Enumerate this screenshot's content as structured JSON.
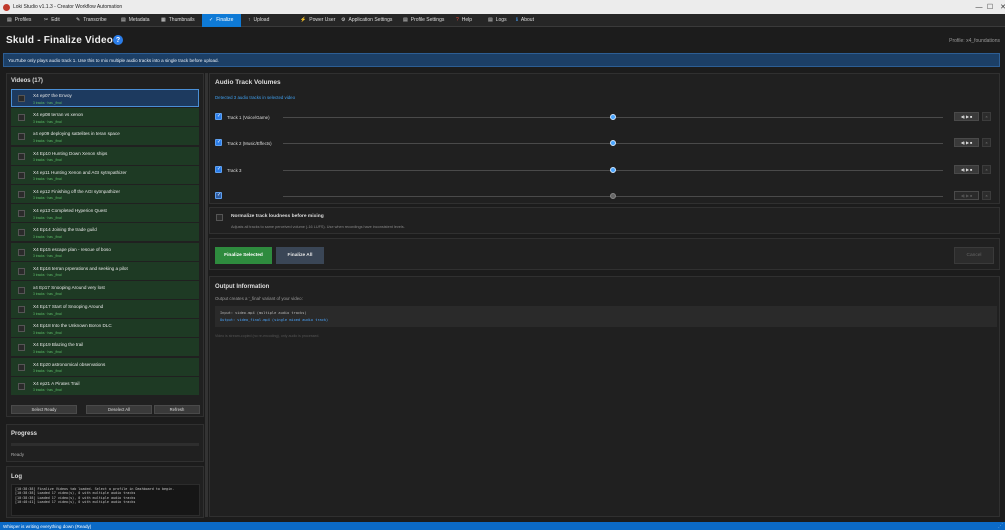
{
  "window": {
    "title": "Loki Studio v1.1.3 - Creator Workflow Automation",
    "minimize": "—",
    "maximize": "☐",
    "close": "✕"
  },
  "tabs": [
    {
      "icon": "▤",
      "label": "Profiles"
    },
    {
      "icon": "✂",
      "label": "Edit"
    },
    {
      "icon": "✎",
      "label": "Transcribe"
    },
    {
      "icon": "▤",
      "label": "Metadata"
    },
    {
      "icon": "▦",
      "label": "Thumbnails"
    },
    {
      "icon": "✓",
      "label": "Finalize"
    },
    {
      "icon": "↑",
      "label": "Upload"
    },
    {
      "icon": "⚡",
      "label": "Power User"
    },
    {
      "icon": "⚙",
      "label": "Application Settings"
    },
    {
      "icon": "▤",
      "label": "Profile Settings"
    },
    {
      "icon": "?",
      "label": "Help"
    },
    {
      "icon": "▤",
      "label": "Logs"
    },
    {
      "icon": "ℹ",
      "label": "About"
    }
  ],
  "header": {
    "title": "Skuld - Finalize Videos",
    "help_icon": "?",
    "profile": "Profile: x4_foundations"
  },
  "banner": "YouTube only plays audio track 1. Use this to mix multiple audio tracks into a single track before upload.",
  "videos": {
    "title": "Videos (17)",
    "items": [
      {
        "title": "X4 ep07 the Envoy",
        "subtitle": "3 tracks · has _final"
      },
      {
        "title": "X4 ep08 terran vs xenon",
        "subtitle": "3 tracks · has _final"
      },
      {
        "title": "x4 ep09 deploying sattelites in teran space",
        "subtitle": "3 tracks · has _final"
      },
      {
        "title": "X4 Ep10 Hunting Down Xenon ships",
        "subtitle": "3 tracks · has _final"
      },
      {
        "title": "X4 ep11 Hunting Xenon and AGI sytmpathizer",
        "subtitle": "3 tracks · has _final"
      },
      {
        "title": "X4 ep12 Finishing off the AGI sytmpathizer",
        "subtitle": "3 tracks · has _final"
      },
      {
        "title": "X4 ep13 Completed Hyperion Quest",
        "subtitle": "3 tracks · has _final"
      },
      {
        "title": "X4 Ep14 Joining the trade guild",
        "subtitle": "3 tracks · has _final"
      },
      {
        "title": "X4 Ep15 escape plan - rescue of boso",
        "subtitle": "3 tracks · has _final"
      },
      {
        "title": "X4 Ep16 terran prperations and seeking a pilot",
        "subtitle": "3 tracks · has _final"
      },
      {
        "title": "x4 Ep17 Snooping Around very lost",
        "subtitle": "3 tracks · has _final"
      },
      {
        "title": "X4 Ep17 Start of Snooping Around",
        "subtitle": "3 tracks · has _final"
      },
      {
        "title": "X4 Ep18 Into the Unknown Boron DLC",
        "subtitle": "3 tracks · has _final"
      },
      {
        "title": "X4 Ep19 Blazing the trail",
        "subtitle": "3 tracks · has _final"
      },
      {
        "title": "X4 Ep20 astronomical observations",
        "subtitle": "3 tracks · has _final"
      },
      {
        "title": "X4 ep21 A Pirates Trail",
        "subtitle": "3 tracks · has _final"
      }
    ],
    "select_ready": "Select Ready",
    "deselect_all": "Deselect All",
    "refresh": "Refresh"
  },
  "progress": {
    "title": "Progress",
    "value": 0,
    "status": "Ready"
  },
  "log": {
    "title": "Log",
    "lines": [
      "[10:38:38] Finalize Videos tab loaded. Select a profile in Dashboard to begin.",
      "[10:38:38] Loaded 17 video(s), 0 with multiple audio tracks",
      "[10:38:38] Loaded 17 video(s), 0 with multiple audio tracks",
      "[10:40:41] Loaded 17 video(s), 0 with multiple audio tracks"
    ]
  },
  "audio": {
    "title": "Audio Track Volumes",
    "detected": "Detected 3 audio tracks in selected video",
    "tracks": [
      {
        "label": "Track 1 (Voice/Game)",
        "value": 0.5,
        "preview": "◀) ▶ ■",
        "remove": "×",
        "enabled": true
      },
      {
        "label": "Track 2 (Music/Effects)",
        "value": 0.5,
        "preview": "◀) ▶ ■",
        "remove": "×",
        "enabled": true
      },
      {
        "label": "Track 3",
        "value": 0.5,
        "preview": "◀) ▶ ■",
        "remove": "×",
        "enabled": true
      },
      {
        "label": "",
        "value": 0.5,
        "preview": "◀) ▶ ■",
        "remove": "×",
        "enabled": false
      }
    ]
  },
  "normalize": {
    "label": "Normalize track loudness before mixing",
    "desc": "Adjusts all tracks to same perceived volume (-16 LUFS). Use when recordings have inconsistent levels.",
    "checked": false
  },
  "actions": {
    "finalize_selected": "Finalize Selected",
    "finalize_all": "Finalize All",
    "cancel": "Cancel"
  },
  "output": {
    "title": "Output Information",
    "desc": "Output creates a '_final' variant of your video:",
    "input_line": "Input: video.mp4 (multiple audio tracks)",
    "output_line": "Output: video_final.mp4 (single mixed audio track)",
    "note": "Video is stream-copied (no re-encoding), only audio is processed."
  },
  "statusbar": {
    "text": "Whisper is writing everything down (Ready)",
    "grip": "⋰"
  },
  "colors": {
    "accent": "#0e7ad6",
    "ready_green": "#1e3a24",
    "finalize_green": "#2e8b3e",
    "statusbar": "#0b6ac7"
  }
}
